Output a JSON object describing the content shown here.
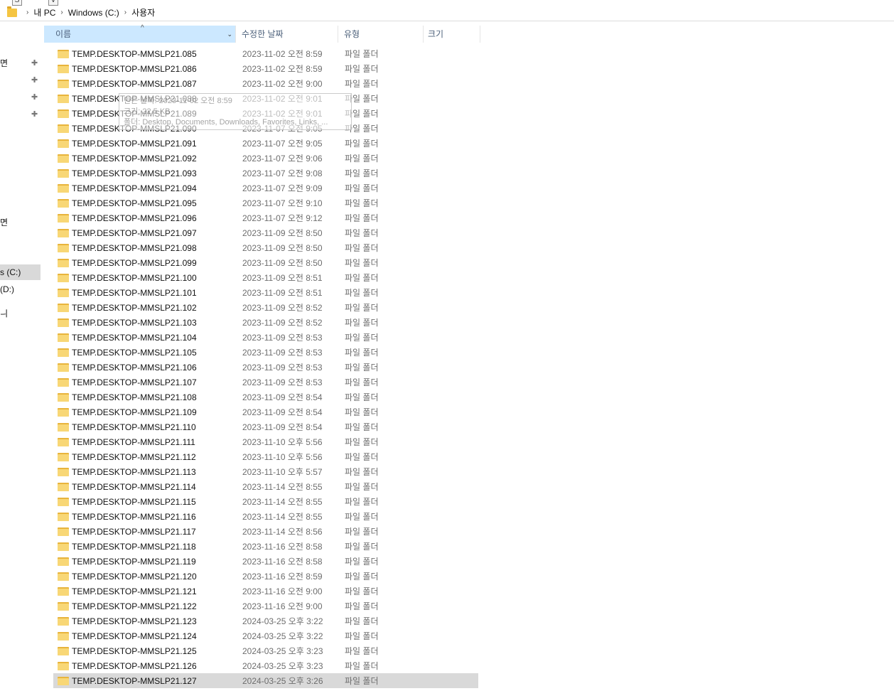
{
  "keytips": [
    "S",
    "V"
  ],
  "address": {
    "crumbs": [
      "내 PC",
      "Windows (C:)",
      "사용자"
    ]
  },
  "nav": {
    "items": [
      "면",
      "",
      "",
      "",
      "면",
      "s (C:)",
      "(D:)",
      "ㅢ"
    ]
  },
  "header": {
    "name": "이름",
    "date": "수정한 날짜",
    "type": "유형",
    "size": "크기"
  },
  "tooltip": {
    "line1": "만든 날짜: 2023-11-02 오전 8:59",
    "line2": "크기: 22.5 KB",
    "line3": "폴더: Desktop, Documents, Downloads, Favorites, Links, ..."
  },
  "files": [
    {
      "name": "TEMP.DESKTOP-MMSLP21.085",
      "date": "2023-11-02 오전 8:59",
      "type": "파일 폴더"
    },
    {
      "name": "TEMP.DESKTOP-MMSLP21.086",
      "date": "2023-11-02 오전 8:59",
      "type": "파일 폴더"
    },
    {
      "name": "TEMP.DESKTOP-MMSLP21.087",
      "date": "2023-11-02 오전 9:00",
      "type": "파일 폴더"
    },
    {
      "name": "TEMP.DESKTOP-MMSLP21.088",
      "date": "2023-11-02 오전 9:01",
      "type": "파일 폴더"
    },
    {
      "name": "TEMP.DESKTOP-MMSLP21.089",
      "date": "2023-11-02 오전 9:01",
      "type": "파일 폴더"
    },
    {
      "name": "TEMP.DESKTOP-MMSLP21.090",
      "date": "2023-11-07 오전 9:05",
      "type": "파일 폴더"
    },
    {
      "name": "TEMP.DESKTOP-MMSLP21.091",
      "date": "2023-11-07 오전 9:05",
      "type": "파일 폴더"
    },
    {
      "name": "TEMP.DESKTOP-MMSLP21.092",
      "date": "2023-11-07 오전 9:06",
      "type": "파일 폴더"
    },
    {
      "name": "TEMP.DESKTOP-MMSLP21.093",
      "date": "2023-11-07 오전 9:08",
      "type": "파일 폴더"
    },
    {
      "name": "TEMP.DESKTOP-MMSLP21.094",
      "date": "2023-11-07 오전 9:09",
      "type": "파일 폴더"
    },
    {
      "name": "TEMP.DESKTOP-MMSLP21.095",
      "date": "2023-11-07 오전 9:10",
      "type": "파일 폴더"
    },
    {
      "name": "TEMP.DESKTOP-MMSLP21.096",
      "date": "2023-11-07 오전 9:12",
      "type": "파일 폴더"
    },
    {
      "name": "TEMP.DESKTOP-MMSLP21.097",
      "date": "2023-11-09 오전 8:50",
      "type": "파일 폴더"
    },
    {
      "name": "TEMP.DESKTOP-MMSLP21.098",
      "date": "2023-11-09 오전 8:50",
      "type": "파일 폴더"
    },
    {
      "name": "TEMP.DESKTOP-MMSLP21.099",
      "date": "2023-11-09 오전 8:50",
      "type": "파일 폴더"
    },
    {
      "name": "TEMP.DESKTOP-MMSLP21.100",
      "date": "2023-11-09 오전 8:51",
      "type": "파일 폴더"
    },
    {
      "name": "TEMP.DESKTOP-MMSLP21.101",
      "date": "2023-11-09 오전 8:51",
      "type": "파일 폴더"
    },
    {
      "name": "TEMP.DESKTOP-MMSLP21.102",
      "date": "2023-11-09 오전 8:52",
      "type": "파일 폴더"
    },
    {
      "name": "TEMP.DESKTOP-MMSLP21.103",
      "date": "2023-11-09 오전 8:52",
      "type": "파일 폴더"
    },
    {
      "name": "TEMP.DESKTOP-MMSLP21.104",
      "date": "2023-11-09 오전 8:53",
      "type": "파일 폴더"
    },
    {
      "name": "TEMP.DESKTOP-MMSLP21.105",
      "date": "2023-11-09 오전 8:53",
      "type": "파일 폴더"
    },
    {
      "name": "TEMP.DESKTOP-MMSLP21.106",
      "date": "2023-11-09 오전 8:53",
      "type": "파일 폴더"
    },
    {
      "name": "TEMP.DESKTOP-MMSLP21.107",
      "date": "2023-11-09 오전 8:53",
      "type": "파일 폴더"
    },
    {
      "name": "TEMP.DESKTOP-MMSLP21.108",
      "date": "2023-11-09 오전 8:54",
      "type": "파일 폴더"
    },
    {
      "name": "TEMP.DESKTOP-MMSLP21.109",
      "date": "2023-11-09 오전 8:54",
      "type": "파일 폴더"
    },
    {
      "name": "TEMP.DESKTOP-MMSLP21.110",
      "date": "2023-11-09 오전 8:54",
      "type": "파일 폴더"
    },
    {
      "name": "TEMP.DESKTOP-MMSLP21.111",
      "date": "2023-11-10 오후 5:56",
      "type": "파일 폴더"
    },
    {
      "name": "TEMP.DESKTOP-MMSLP21.112",
      "date": "2023-11-10 오후 5:56",
      "type": "파일 폴더"
    },
    {
      "name": "TEMP.DESKTOP-MMSLP21.113",
      "date": "2023-11-10 오후 5:57",
      "type": "파일 폴더"
    },
    {
      "name": "TEMP.DESKTOP-MMSLP21.114",
      "date": "2023-11-14 오전 8:55",
      "type": "파일 폴더"
    },
    {
      "name": "TEMP.DESKTOP-MMSLP21.115",
      "date": "2023-11-14 오전 8:55",
      "type": "파일 폴더"
    },
    {
      "name": "TEMP.DESKTOP-MMSLP21.116",
      "date": "2023-11-14 오전 8:55",
      "type": "파일 폴더"
    },
    {
      "name": "TEMP.DESKTOP-MMSLP21.117",
      "date": "2023-11-14 오전 8:56",
      "type": "파일 폴더"
    },
    {
      "name": "TEMP.DESKTOP-MMSLP21.118",
      "date": "2023-11-16 오전 8:58",
      "type": "파일 폴더"
    },
    {
      "name": "TEMP.DESKTOP-MMSLP21.119",
      "date": "2023-11-16 오전 8:58",
      "type": "파일 폴더"
    },
    {
      "name": "TEMP.DESKTOP-MMSLP21.120",
      "date": "2023-11-16 오전 8:59",
      "type": "파일 폴더"
    },
    {
      "name": "TEMP.DESKTOP-MMSLP21.121",
      "date": "2023-11-16 오전 9:00",
      "type": "파일 폴더"
    },
    {
      "name": "TEMP.DESKTOP-MMSLP21.122",
      "date": "2023-11-16 오전 9:00",
      "type": "파일 폴더"
    },
    {
      "name": "TEMP.DESKTOP-MMSLP21.123",
      "date": "2024-03-25 오후 3:22",
      "type": "파일 폴더"
    },
    {
      "name": "TEMP.DESKTOP-MMSLP21.124",
      "date": "2024-03-25 오후 3:22",
      "type": "파일 폴더"
    },
    {
      "name": "TEMP.DESKTOP-MMSLP21.125",
      "date": "2024-03-25 오후 3:23",
      "type": "파일 폴더"
    },
    {
      "name": "TEMP.DESKTOP-MMSLP21.126",
      "date": "2024-03-25 오후 3:23",
      "type": "파일 폴더"
    },
    {
      "name": "TEMP.DESKTOP-MMSLP21.127",
      "date": "2024-03-25 오후 3:26",
      "type": "파일 폴더",
      "selected": true
    }
  ]
}
